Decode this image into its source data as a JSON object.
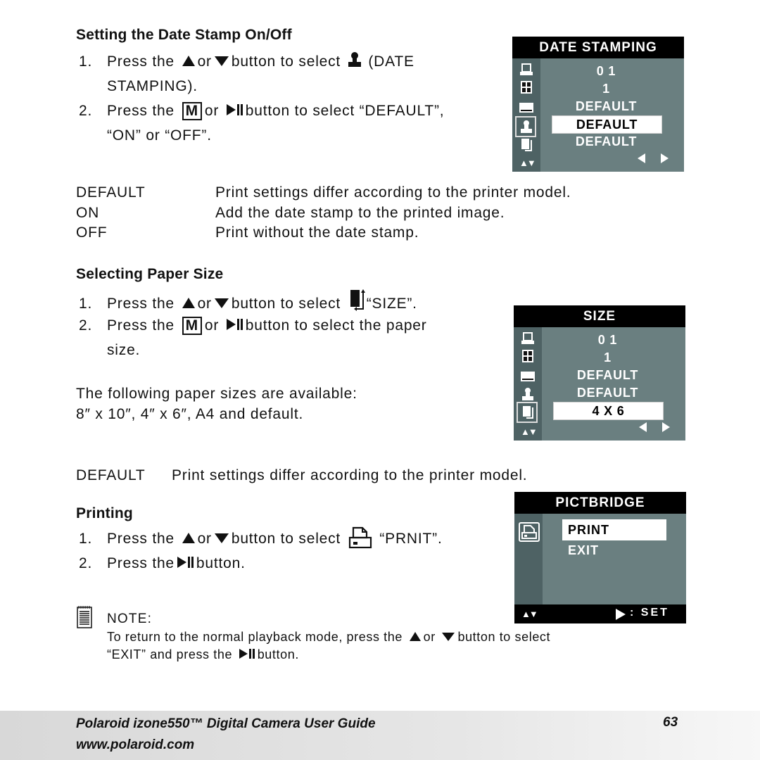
{
  "section1": {
    "heading": "Setting the Date Stamp On/Off",
    "step1_num": "1.",
    "step1_a": "Press the",
    "step1_or": "or",
    "step1_b": "button to select",
    "step1_c": "(DATE",
    "step1_line2": "STAMPING).",
    "step2_num": "2.",
    "step2_a": "Press the",
    "step2_m": "M",
    "step2_or": "or",
    "step2_b": "button to select “DEFAULT”,",
    "step2_line2": "“ON” or “OFF”.",
    "definitions": [
      {
        "term": "DEFAULT",
        "desc": "Print settings differ according to the printer model."
      },
      {
        "term": "ON",
        "desc": "Add the date stamp to the printed image."
      },
      {
        "term": "OFF",
        "desc": "Print without the date stamp."
      }
    ]
  },
  "lcd_date": {
    "title": "DATE STAMPING",
    "rows": [
      "0 1",
      "1",
      "DEFAULT",
      "DEFAULT",
      "DEFAULT"
    ],
    "selected_index": 3,
    "icons": [
      "printer-icon",
      "layout-grid-icon",
      "border-icon",
      "stamp-icon",
      "paper-size-icon"
    ],
    "nav_icon": "up-down-icon"
  },
  "section2": {
    "heading": "Selecting Paper Size",
    "step1_num": "1.",
    "step1_a": "Press the",
    "step1_or": "or",
    "step1_b": "button to select",
    "step1_c": "“SIZE”.",
    "step2_num": "2.",
    "step2_a": "Press the",
    "step2_m": "M",
    "step2_or": "or",
    "step2_b": "button to select the paper",
    "step2_line2": "size.",
    "avail_1": "The following paper sizes are available:",
    "avail_2": "8″ x 10″, 4″ x 6″, A4 and default.",
    "def_term": "DEFAULT",
    "def_desc": "Print settings differ according to the printer model."
  },
  "lcd_size": {
    "title": "SIZE",
    "rows": [
      "0 1",
      "1",
      "DEFAULT",
      "DEFAULT",
      "4 X 6"
    ],
    "selected_index": 4
  },
  "section3": {
    "heading": "Printing",
    "step1_num": "1.",
    "step1_a": "Press the",
    "step1_or": "or",
    "step1_b": "button to select",
    "step1_c": "“PRNIT”.",
    "step2_num": "2.",
    "step2_a": "Press the",
    "step2_b": "button."
  },
  "lcd_pict": {
    "title": "PICTBRIDGE",
    "rows": [
      "PRINT",
      "EXIT"
    ],
    "selected_index": 0,
    "footer_right": ": SET"
  },
  "note": {
    "label": "NOTE:",
    "line1_a": "To return to the normal playback mode, press the",
    "line1_or": "or",
    "line1_b": "button to select",
    "line2_a": "“EXIT” and press the",
    "line2_b": "button."
  },
  "footer": {
    "title": "Polaroid izone550™ Digital Camera User Guide",
    "url": "www.polaroid.com",
    "page": "63"
  }
}
